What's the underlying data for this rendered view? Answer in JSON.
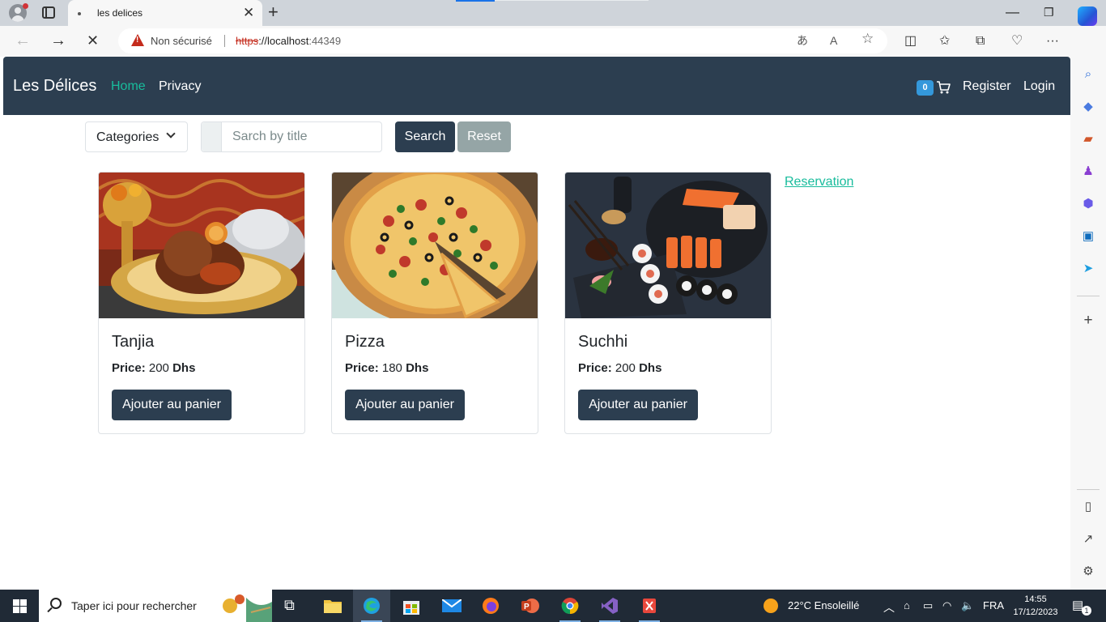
{
  "browser": {
    "tab_title": "les delices",
    "security_label": "Non sécurisé",
    "url_scheme": "https",
    "url_sep": "://",
    "url_host": "localhost",
    "url_port": ":44349"
  },
  "navbar": {
    "brand": "Les Délices",
    "links": [
      "Home",
      "Privacy"
    ],
    "cart_count": "0",
    "register": "Register",
    "login": "Login"
  },
  "filters": {
    "categories_label": "Categories",
    "search_placeholder": "Sarch by title",
    "search_button": "Search",
    "reset_button": "Reset"
  },
  "products": [
    {
      "title": "Tanjia",
      "price_label": "Price:",
      "price_value": "200",
      "currency": "Dhs",
      "button": "Ajouter au panier"
    },
    {
      "title": "Pizza",
      "price_label": "Price:",
      "price_value": "180",
      "currency": "Dhs",
      "button": "Ajouter au panier"
    },
    {
      "title": "Suchhi",
      "price_label": "Price:",
      "price_value": "200",
      "currency": "Dhs",
      "button": "Ajouter au panier"
    }
  ],
  "reservation_link": "Reservation",
  "taskbar": {
    "search_placeholder": "Taper ici pour rechercher",
    "weather": "22°C  Ensoleillé",
    "language": "FRA",
    "time": "14:55",
    "date": "17/12/2023",
    "notification_count": "1"
  },
  "colors": {
    "navbar_bg": "#2c3e50",
    "accent": "#18bc9c",
    "badge": "#3498db",
    "reset_btn": "#95a5a6"
  }
}
